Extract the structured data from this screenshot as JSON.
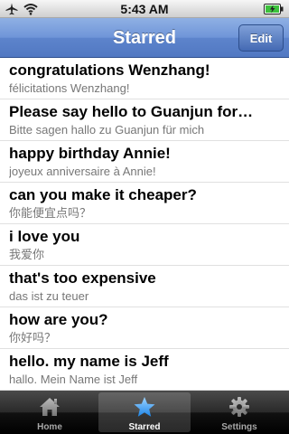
{
  "status_bar": {
    "time": "5:43 AM"
  },
  "nav": {
    "title": "Starred",
    "edit_label": "Edit"
  },
  "items": [
    {
      "phrase": "congratulations Wenzhang!",
      "translation": "félicitations Wenzhang!"
    },
    {
      "phrase": "Please say hello to Guanjun for…",
      "translation": "Bitte sagen hallo zu Guanjun für mich"
    },
    {
      "phrase": "happy birthday Annie!",
      "translation": "joyeux anniversaire à Annie!"
    },
    {
      "phrase": "can you make it cheaper?",
      "translation": "你能便宜点吗？"
    },
    {
      "phrase": "i love you",
      "translation": "我爱你"
    },
    {
      "phrase": "that's too expensive",
      "translation": "das ist zu teuer"
    },
    {
      "phrase": "how are you?",
      "translation": "你好吗？"
    },
    {
      "phrase": "hello. my name is Jeff",
      "translation": "hallo. Mein Name ist Jeff"
    }
  ],
  "tabs": [
    {
      "label": "Home",
      "icon": "home-icon",
      "selected": false
    },
    {
      "label": "Starred",
      "icon": "star-icon",
      "selected": true
    },
    {
      "label": "Settings",
      "icon": "gear-icon",
      "selected": false
    }
  ],
  "colors": {
    "nav_blue": "#5d84cc",
    "selected_tab_icon": "#4aa3ff"
  }
}
